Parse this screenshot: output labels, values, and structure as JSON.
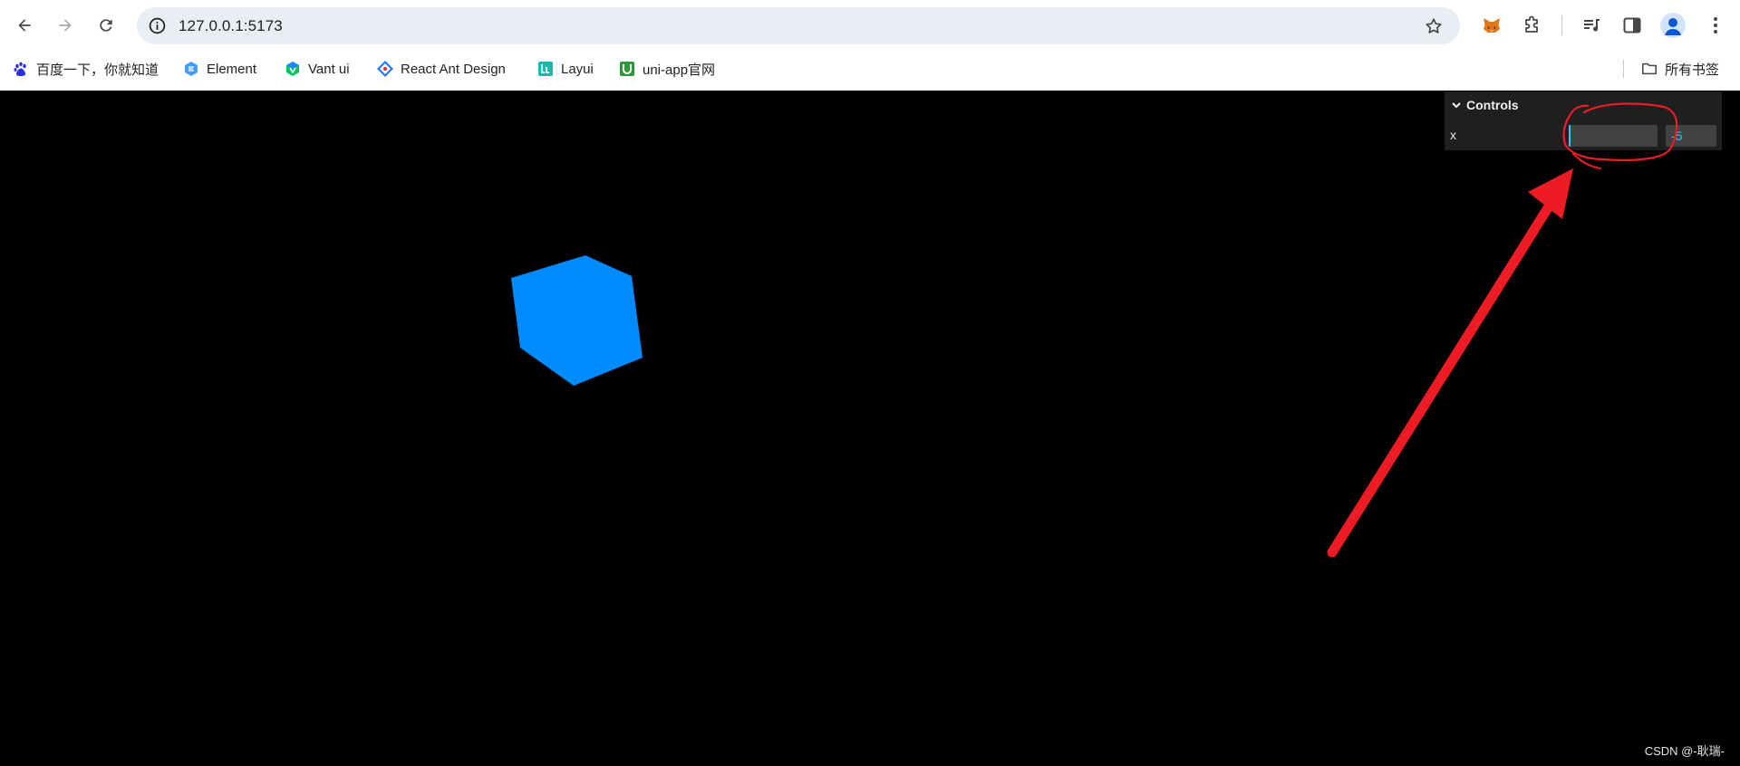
{
  "browser": {
    "url": "127.0.0.1:5173"
  },
  "bookmarks": {
    "items": [
      {
        "label": "百度一下，你就知道",
        "icon": "baidu-icon"
      },
      {
        "label": "Element",
        "icon": "element-icon"
      },
      {
        "label": "Vant ui",
        "icon": "vant-icon"
      },
      {
        "label": "React Ant Design",
        "icon": "ant-design-icon"
      },
      {
        "label": "Layui",
        "icon": "layui-icon"
      },
      {
        "label": "uni-app官网",
        "icon": "uniapp-icon"
      }
    ],
    "all_bookmarks": "所有书签"
  },
  "controls": {
    "title": "Controls",
    "x_label": "x",
    "x_value": "-5",
    "x_fill_fraction": 0.0
  },
  "scene": {
    "cube_color": "#008cff",
    "background": "#000000"
  },
  "watermark": "CSDN @-耿瑞-",
  "colors": {
    "accent": "#2cc9ff",
    "annotation": "#ed1c24"
  }
}
